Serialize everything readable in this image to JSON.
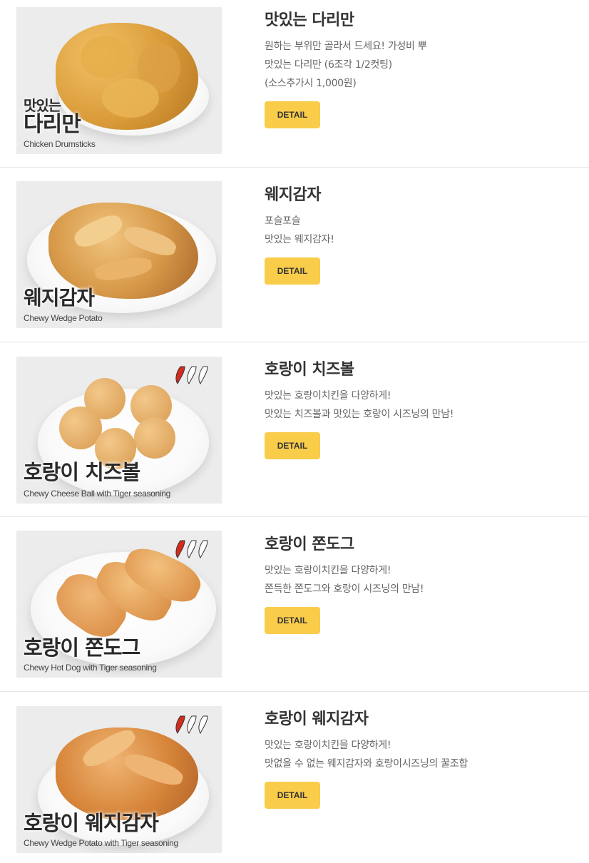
{
  "items": [
    {
      "title": "맛있는 다리만",
      "desc": [
        "원하는 부위만 골라서 드세요! 가성비 뿌",
        "맛있는 다리만 (6조각 1/2컷팅)",
        "(소스추가시 1,000원)"
      ],
      "button_label": "DETAIL",
      "image_ko_small": "맛있는",
      "image_ko": "다리만",
      "image_en": "Chicken Drumsticks",
      "spicy": false
    },
    {
      "title": "웨지감자",
      "desc": [
        "포슬포슬",
        "맛있는 웨지감자!"
      ],
      "button_label": "DETAIL",
      "image_ko": "웨지감자",
      "image_en": "Chewy Wedge Potato",
      "spicy": false
    },
    {
      "title": "호랑이 치즈볼",
      "desc": [
        "맛있는 호랑이치킨을 다양하게!",
        "맛있는 치즈볼과 맛있는 호랑이 시즈닝의 만남!"
      ],
      "button_label": "DETAIL",
      "image_ko": "호랑이 치즈볼",
      "image_en": "Chewy Cheese Ball with Tiger seasoning",
      "spicy": true
    },
    {
      "title": "호랑이 쫀도그",
      "desc": [
        "맛있는 호랑이치킨을 다양하게!",
        "쫀득한 쫀도그와 호랑이 시즈닝의 만남!"
      ],
      "button_label": "DETAIL",
      "image_ko": "호랑이 쫀도그",
      "image_en": "Chewy Hot Dog with Tiger seasoning",
      "spicy": true
    },
    {
      "title": "호랑이 웨지감자",
      "desc": [
        "맛있는 호랑이치킨을 다양하게!",
        "맛없을 수 없는 웨지감자와 호랑이시즈닝의 꿀조합"
      ],
      "button_label": "DETAIL",
      "image_ko": "호랑이 웨지감자",
      "image_en": "Chewy Wedge Potato with Tiger seasoning",
      "spicy": true
    }
  ],
  "colors": {
    "button": "#f9cc4a",
    "divider": "#e6e6e6",
    "title": "#333333",
    "desc": "#666666"
  }
}
